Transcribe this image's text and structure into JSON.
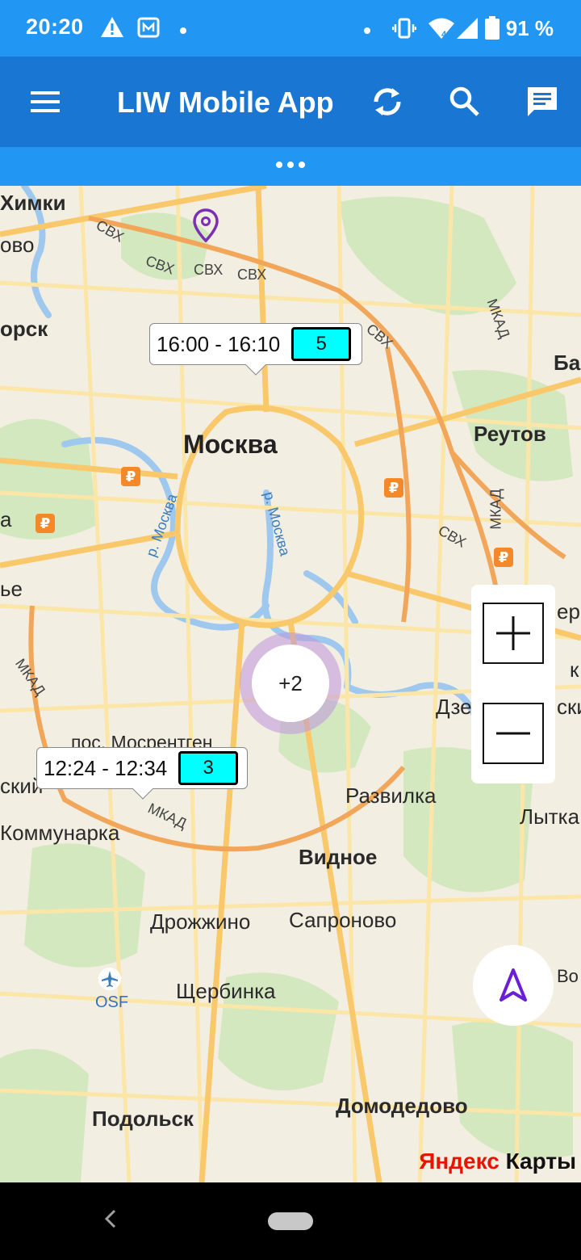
{
  "status_bar": {
    "time": "20:20",
    "battery_pct": "91 %",
    "icons": [
      "warning-icon",
      "notification-m-icon",
      "dot-icon",
      "vibrate-icon",
      "wifi-icon",
      "signal-icon",
      "battery-icon"
    ]
  },
  "app_bar": {
    "title": "LIW Mobile App",
    "icons": [
      "menu-icon",
      "refresh-icon",
      "search-icon",
      "message-icon"
    ]
  },
  "map": {
    "cities_big": [
      {
        "name": "city-moscow",
        "label": "Москва"
      }
    ],
    "places": [
      {
        "name": "place-khimki",
        "label": "Химки"
      },
      {
        "name": "place-vo",
        "label": "ово"
      },
      {
        "name": "place-rsk",
        "label": "орск"
      },
      {
        "name": "place-ba",
        "label": "Ба"
      },
      {
        "name": "place-reutov",
        "label": "Реутов"
      },
      {
        "name": "place-e",
        "label": "ье"
      },
      {
        "name": "place-mosrentgen",
        "label": "пос. Мосрентген"
      },
      {
        "name": "place-skiy",
        "label": "ский"
      },
      {
        "name": "place-kommunarka",
        "label": "Коммунарка"
      },
      {
        "name": "place-razvilka",
        "label": "Развилка"
      },
      {
        "name": "place-lytka",
        "label": "Лытка"
      },
      {
        "name": "place-vidnoe",
        "label": "Видное"
      },
      {
        "name": "place-drozhzhino",
        "label": "Дрожжино"
      },
      {
        "name": "place-sapronovo",
        "label": "Сапроново"
      },
      {
        "name": "place-shcherbinka",
        "label": "Щербинка"
      },
      {
        "name": "place-podolsk",
        "label": "Подольск"
      },
      {
        "name": "place-domodedovo",
        "label": "Домодедово"
      },
      {
        "name": "place-dze",
        "label": "Дзе"
      },
      {
        "name": "place-skiy-right",
        "label": "ский"
      },
      {
        "name": "place-ep",
        "label": "ер"
      },
      {
        "name": "place-k",
        "label": "к"
      },
      {
        "name": "place-vo-right",
        "label": "Во"
      },
      {
        "name": "place-osf",
        "label": "OSF"
      },
      {
        "name": "place-a",
        "label": "а"
      }
    ],
    "roads": [
      "СВХ",
      "СВХ",
      "СВХ",
      "СВХ",
      "СВХ",
      "СВХ",
      "МКАД",
      "МКАД",
      "МКАД",
      "МКАД"
    ],
    "rivers": [
      "р. Москва",
      "р. Москва"
    ],
    "callouts": [
      {
        "time": "16:00 - 16:10",
        "count": "5"
      },
      {
        "time": "12:24 - 12:34",
        "count": "3"
      }
    ],
    "cluster": "+2",
    "ruble_symbol": "₽",
    "zoom": {
      "plus": "+",
      "minus": "—"
    },
    "brand_red": "Яндекс",
    "brand_dark": " Карты"
  },
  "colors": {
    "status_bar": "#2196f3",
    "app_bar": "#1976d2",
    "badge": "#00ffff",
    "pin": "#7b2fb3",
    "locate_arrow": "#6a1fd6"
  }
}
